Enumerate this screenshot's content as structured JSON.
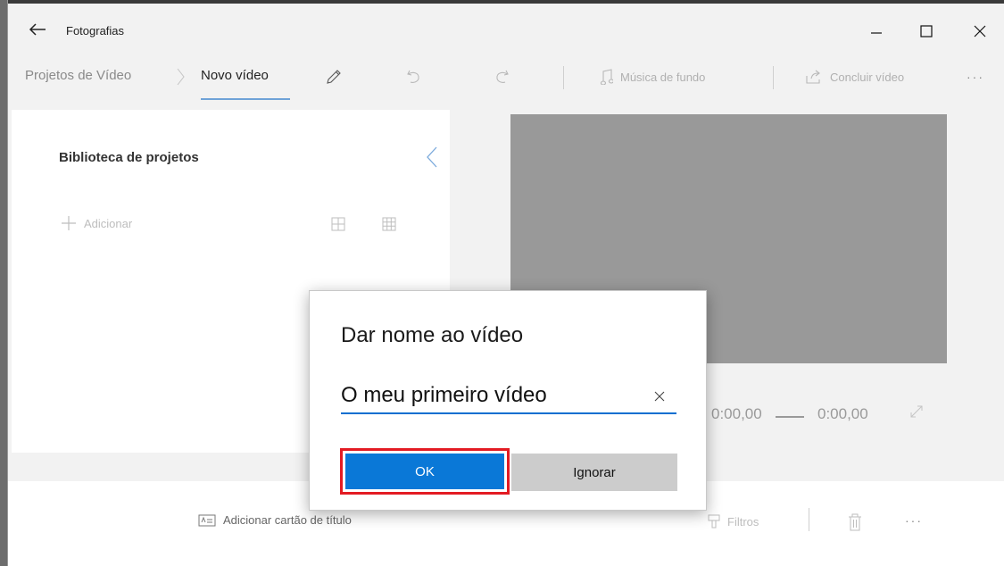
{
  "app": {
    "title": "Fotografias"
  },
  "breadcrumb": {
    "parent": "Projetos de Vídeo",
    "current": "Novo vídeo"
  },
  "commands": {
    "music": "Música de fundo",
    "finish": "Concluir vídeo",
    "more": "···"
  },
  "library": {
    "title": "Biblioteca de projetos",
    "add": "Adicionar"
  },
  "playback": {
    "current_time": "0:00,00",
    "total_time": "0:00,00"
  },
  "bottom": {
    "title_card": "Adicionar cartão de título",
    "filters": "Filtros",
    "more": "···"
  },
  "dialog": {
    "title": "Dar nome ao vídeo",
    "input_value": "O meu primeiro vídeo",
    "ok": "OK",
    "ignore": "Ignorar"
  },
  "colors": {
    "accent": "#0a78d7",
    "highlight": "#e31b23",
    "preview": "#999999"
  }
}
